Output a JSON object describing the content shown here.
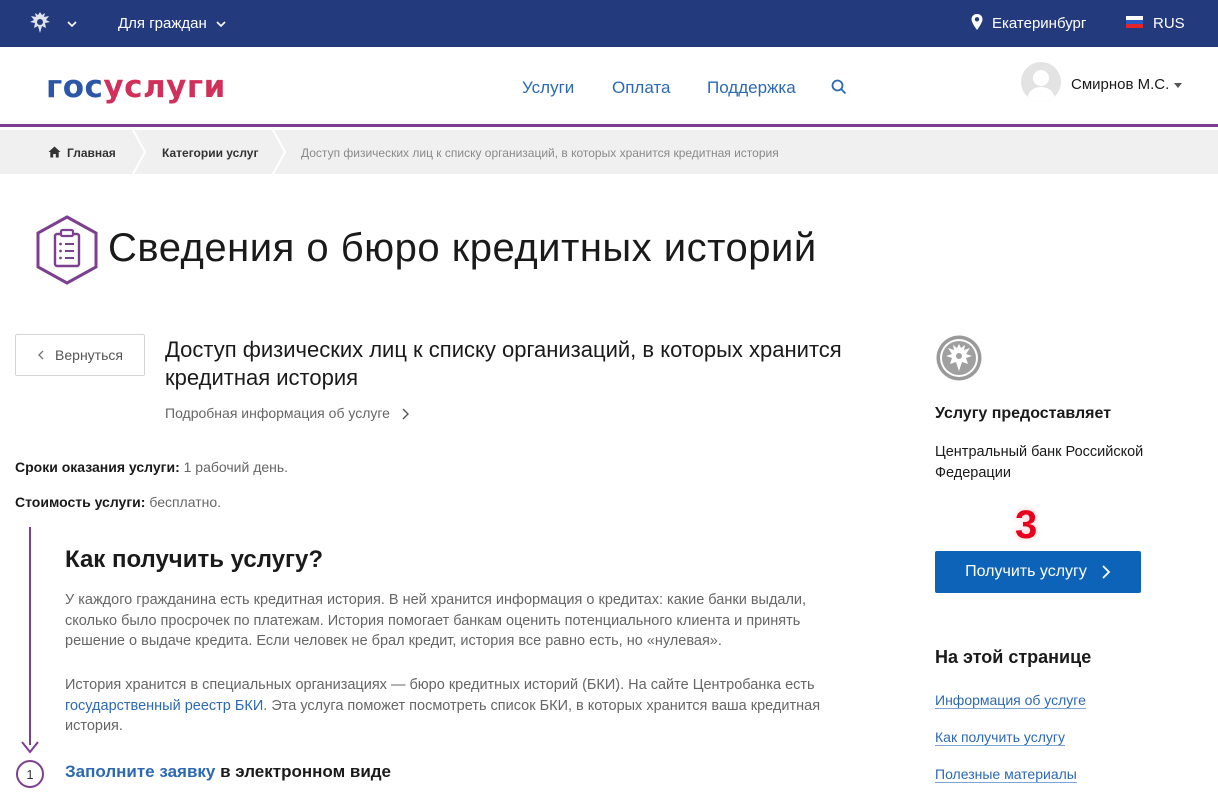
{
  "topbar": {
    "for_citizens": "Для граждан",
    "city": "Екатеринбург",
    "lang": "RUS"
  },
  "header": {
    "logo_part1": "гос",
    "logo_part2": "услуги",
    "nav": [
      "Услуги",
      "Оплата",
      "Поддержка"
    ],
    "username": "Смирнов М.С."
  },
  "breadcrumbs": {
    "home": "Главная",
    "category": "Категории услуг",
    "current": "Доступ физических лиц к списку организаций, в которых хранится кредитная история"
  },
  "page_title": "Сведения о бюро кредитных историй",
  "back_label": "Вернуться",
  "service": {
    "title": "Доступ физических лиц к списку организаций, в которых хранится кредитная история",
    "details_link": "Подробная информация об услуге",
    "term_label": "Сроки оказания услуги:",
    "term_value": " 1 рабочий день.",
    "cost_label": "Стоимость услуги:",
    "cost_value": " бесплатно."
  },
  "how": {
    "title": "Как получить услугу?",
    "para1": "У каждого гражданина есть кредитная история. В ней хранится информация о кредитах: какие банки выдали, сколько было просрочек по платежам. История помогает банкам оценить потенциального клиента и принять решение о выдаче кредита. Если человек не брал кредит, история все равно есть, но «нулевая».",
    "para2_before": "История хранится в специальных организациях — бюро кредитных историй (БКИ). На сайте Центробанка есть ",
    "para2_link": "государственный реестр БКИ",
    "para2_after": ". Эта услуга поможет посмотреть список БКИ, в которых хранится ваша кредитная история.",
    "step_number": "1",
    "step_link": "Заполните заявку",
    "step_rest": " в электронном виде"
  },
  "sidebar": {
    "provider_label": "Услугу предоставляет",
    "provider_name": "Центральный банк Российской Федерации",
    "annotation": "3",
    "get_button": "Получить услугу",
    "on_page_title": "На этой странице",
    "anchors": [
      "Информация об услуге",
      "Как получить услугу",
      "Полезные материалы"
    ]
  },
  "colors": {
    "topbar": "#233a7d",
    "accent_purple": "#7d3f8f",
    "link_blue": "#2d69b3",
    "button_blue": "#0d63b7"
  }
}
